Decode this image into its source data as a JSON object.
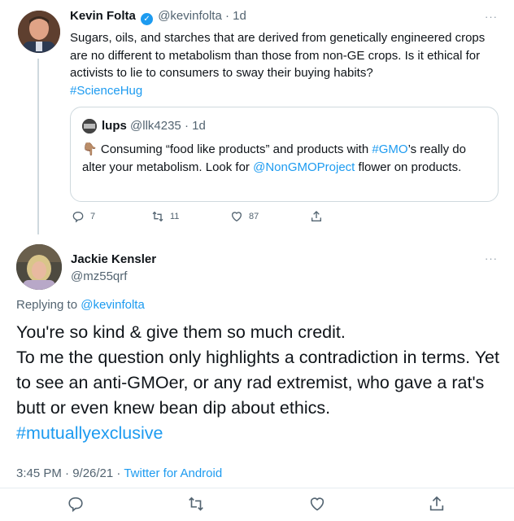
{
  "tweet1": {
    "name": "Kevin Folta",
    "handle": "@kevinfolta",
    "time": "1d",
    "more": "···",
    "text": "Sugars, oils, and starches that are derived from genetically engineered crops are no different to metabolism than those from non-GE crops. Is it ethical for activists to lie to consumers to sway their buying habits?",
    "hashtag": "#ScienceHug",
    "quote": {
      "name": "lups",
      "handle": "@llk4235",
      "time": "1d",
      "emoji": "👇🏽",
      "text_before": "Consuming “food like products” and products with ",
      "hashtag": "#GMO",
      "text_middle": "’s really do alter your metabolism. Look for ",
      "mention": "@NonGMOProject",
      "text_after": " flower on products."
    },
    "actions": {
      "replies": "7",
      "retweets": "11",
      "likes": "87"
    }
  },
  "tweet2": {
    "name": "Jackie Kensler",
    "handle": "@mz55qrf",
    "more": "···",
    "replying_prefix": "Replying to ",
    "replying_to": "@kevinfolta",
    "line1": "You're so kind & give them so much credit.",
    "line2": "To me the question only highlights a contradiction in terms. Yet to see an anti-GMOer, or any rad extremist, who gave a rat's butt or even knew bean dip about ethics.",
    "hashtag": "#mutuallyexclusive",
    "timestamp": "3:45 PM · 9/26/21 · ",
    "source": "Twitter for Android"
  },
  "icons": [
    "reply-icon",
    "retweet-icon",
    "like-icon",
    "share-icon",
    "verified-badge-icon",
    "more-icon"
  ],
  "colors": {
    "link": "#1d9bf0",
    "secondary": "#536471",
    "border": "#cfd9de"
  }
}
